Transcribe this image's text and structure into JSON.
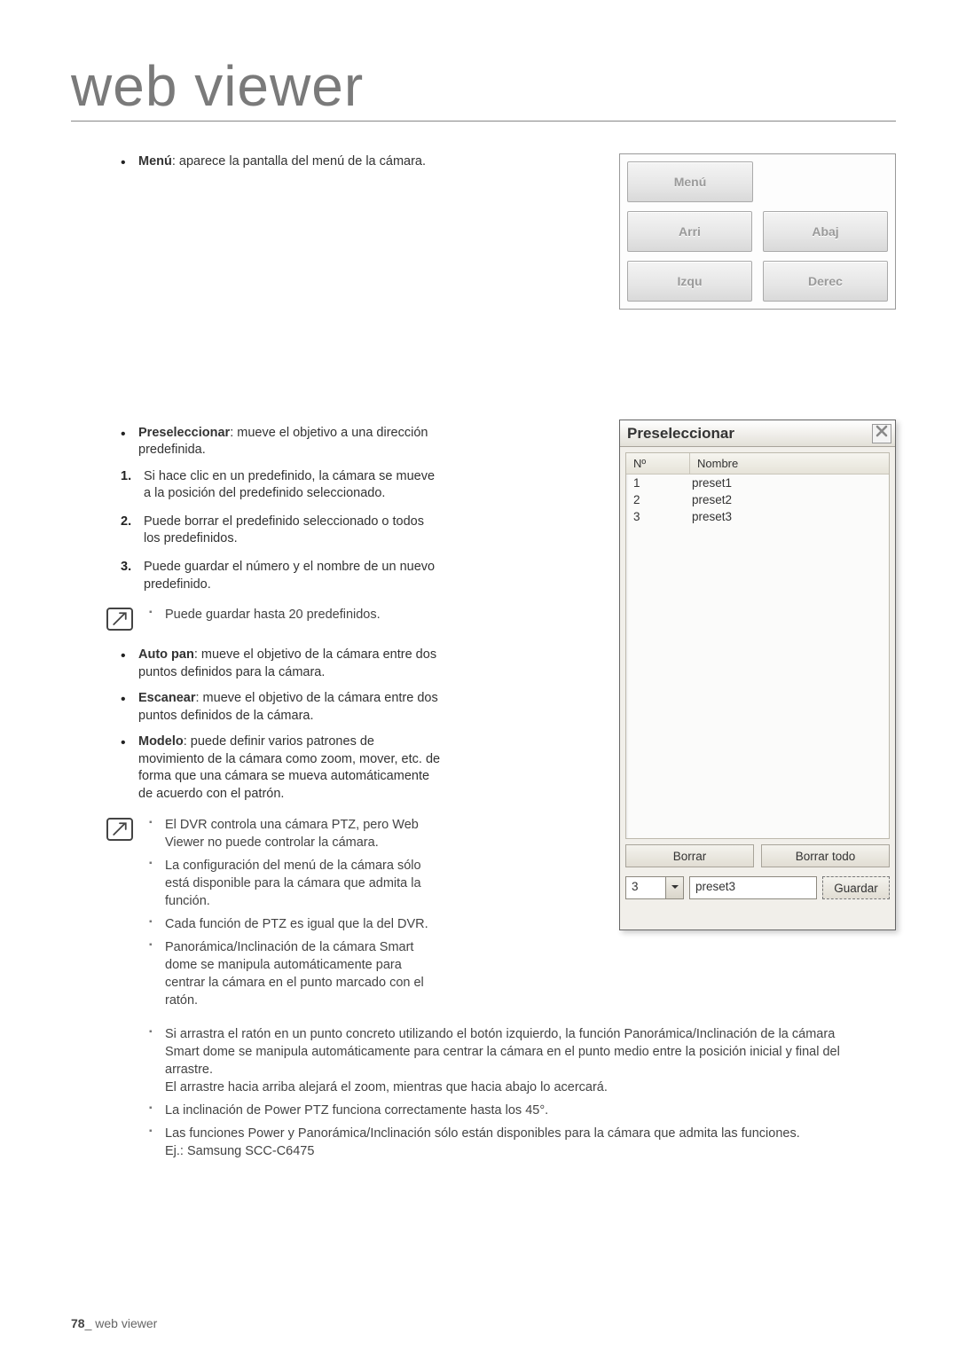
{
  "page": {
    "number": "78",
    "section": "web viewer",
    "title": "web viewer"
  },
  "intro": {
    "menu_label": "Menú",
    "menu_desc": ": aparece la pantalla del menú de la cámara."
  },
  "panel": {
    "menu": "Menú",
    "up": "Arri",
    "down": "Abaj",
    "left": "Izqu",
    "right": "Derec"
  },
  "preselect": {
    "heading_label": "Preseleccionar",
    "heading_desc": ": mueve el objetivo a una dirección predefinida.",
    "steps": [
      "Si hace clic en un predefinido, la cámara se mueve a la posición del predefinido seleccionado.",
      "Puede borrar el predefinido seleccionado o todos los predefinidos.",
      "Puede guardar el número y el nombre de un nuevo predefinido."
    ],
    "note1": "Puede guardar hasta 20 predefinidos."
  },
  "bullets2": [
    {
      "label": "Auto pan",
      "desc": ": mueve el objetivo de la cámara entre dos puntos definidos para la cámara."
    },
    {
      "label": "Escanear",
      "desc": ": mueve el objetivo de la cámara entre dos puntos definidos de la cámara."
    },
    {
      "label": "Modelo",
      "desc": ": puede definir varios patrones de movimiento de la cámara como zoom, mover, etc. de forma que una cámara se mueva automáticamente de acuerdo con el patrón."
    }
  ],
  "note2": [
    "El DVR controla una cámara PTZ, pero Web Viewer no puede controlar la cámara.",
    "La configuración del menú de la cámara sólo está disponible para la cámara que admita la función.",
    "Cada función de PTZ es igual que la del DVR.",
    "Panorámica/Inclinación de la cámara Smart dome se manipula automáticamente para centrar la cámara en el punto marcado con el ratón."
  ],
  "note2_wide": [
    {
      "main": "Si arrastra el ratón en un punto concreto utilizando el botón izquierdo, la función Panorámica/Inclinación de la cámara Smart dome se manipula automáticamente para centrar la cámara en el punto medio entre la posición inicial y final del arrastre.",
      "sub": "El arrastre hacia arriba alejará el zoom, mientras que hacia abajo lo acercará."
    },
    {
      "main": "La inclinación de Power PTZ funciona correctamente hasta los 45°."
    },
    {
      "main": "Las funciones Power y Panorámica/Inclinación sólo están disponibles para la cámara que admita las funciones.",
      "sub": "Ej.: Samsung SCC-C6475"
    }
  ],
  "dialog": {
    "title": "Preseleccionar",
    "col_no": "Nº",
    "col_name": "Nombre",
    "rows": [
      {
        "no": "1",
        "name": "preset1"
      },
      {
        "no": "2",
        "name": "preset2"
      },
      {
        "no": "3",
        "name": "preset3"
      }
    ],
    "delete": "Borrar",
    "delete_all": "Borrar todo",
    "sel_value": "3",
    "txt_value": "preset3",
    "save": "Guardar"
  }
}
